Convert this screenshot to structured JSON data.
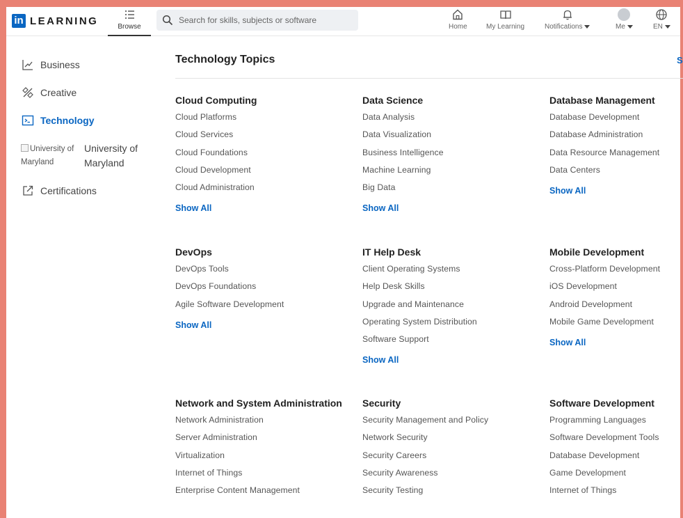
{
  "header": {
    "logo_mark": "in",
    "logo_text": "LEARNING",
    "browse_label": "Browse",
    "search_placeholder": "Search for skills, subjects or software",
    "nav": {
      "home": "Home",
      "my_learning": "My Learning",
      "notifications": "Notifications",
      "me": "Me",
      "language": "EN"
    }
  },
  "sidebar": {
    "items": [
      {
        "label": "Business",
        "icon": "chart-icon"
      },
      {
        "label": "Creative",
        "icon": "pen-tool-icon"
      },
      {
        "label": "Technology",
        "icon": "terminal-icon",
        "active": true
      },
      {
        "label": "Certifications",
        "icon": "external-link-icon"
      }
    ],
    "university": {
      "image_alt": "University of Maryland",
      "name": "University of Maryland"
    }
  },
  "main": {
    "title": "Technology Topics",
    "top_link": "S",
    "show_all_label": "Show All",
    "topics": [
      {
        "title": "Cloud Computing",
        "links": [
          "Cloud Platforms",
          "Cloud Services",
          "Cloud Foundations",
          "Cloud Development",
          "Cloud Administration"
        ]
      },
      {
        "title": "Data Science",
        "links": [
          "Data Analysis",
          "Data Visualization",
          "Business Intelligence",
          "Machine Learning",
          "Big Data"
        ]
      },
      {
        "title": "Database Management",
        "links": [
          "Database Development",
          "Database Administration",
          "Data Resource Management",
          "Data Centers"
        ]
      },
      {
        "title": "DevOps",
        "links": [
          "DevOps Tools",
          "DevOps Foundations",
          "Agile Software Development"
        ]
      },
      {
        "title": "IT Help Desk",
        "links": [
          "Client Operating Systems",
          "Help Desk Skills",
          "Upgrade and Maintenance",
          "Operating System Distribution",
          "Software Support"
        ]
      },
      {
        "title": "Mobile Development",
        "links": [
          "Cross-Platform Development",
          "iOS Development",
          "Android Development",
          "Mobile Game Development"
        ]
      },
      {
        "title": "Network and System Administration",
        "links": [
          "Network Administration",
          "Server Administration",
          "Virtualization",
          "Internet of Things",
          "Enterprise Content Management"
        ]
      },
      {
        "title": "Security",
        "links": [
          "Security Management and Policy",
          "Network Security",
          "Security Careers",
          "Security Awareness",
          "Security Testing"
        ]
      },
      {
        "title": "Software Development",
        "links": [
          "Programming Languages",
          "Software Development Tools",
          "Database Development",
          "Game Development",
          "Internet of Things"
        ]
      }
    ]
  },
  "colors": {
    "accent": "#0a66c2",
    "frame": "#e98274"
  }
}
